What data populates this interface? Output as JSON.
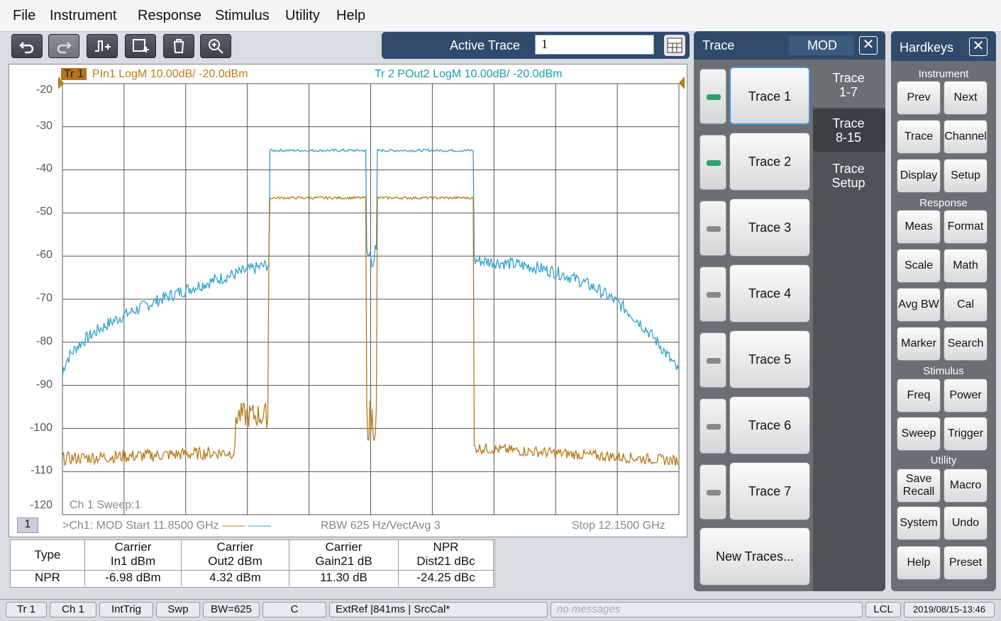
{
  "menu": [
    "File",
    "Instrument",
    "Response",
    "Stimulus",
    "Utility",
    "Help"
  ],
  "active_trace": {
    "label": "Active Trace",
    "value": "1"
  },
  "plot": {
    "tr1_tag": "Tr 1",
    "tr1_header": "PIn1 LogM 10.00dB/ -20.0dBm",
    "tr2_header": "Tr 2  POut2 LogM 10.00dB/ -20.0dBm",
    "y_labels": [
      "-20",
      "-30",
      "-40",
      "-50",
      "-60",
      "-70",
      "-80",
      "-90",
      "-100",
      "-110",
      "-120"
    ],
    "sweep_label": "Ch 1 Sweep:1",
    "channel_num": "1",
    "footer_left": ">Ch1: MOD  Start  11.8500 GHz",
    "footer_mid": "RBW  625 Hz/VectAvg 3",
    "footer_right": "Stop  12.1500 GHz",
    "colors": {
      "trace1": "#b8791a",
      "trace2": "#2f9fd0",
      "grid": "#555555"
    }
  },
  "table": {
    "headers": [
      [
        "Type",
        ""
      ],
      [
        "Carrier",
        "In1 dBm"
      ],
      [
        "Carrier",
        "Out2 dBm"
      ],
      [
        "Carrier",
        "Gain21 dB"
      ],
      [
        "NPR",
        "Dist21 dBc"
      ]
    ],
    "row": [
      "NPR",
      "-6.98 dBm",
      "4.32 dBm",
      "11.30 dB",
      "-24.25 dBc"
    ]
  },
  "trace_panel": {
    "title": "Trace",
    "mode": "MOD",
    "traces": [
      "Trace 1",
      "Trace 2",
      "Trace 3",
      "Trace 4",
      "Trace 5",
      "Trace 6",
      "Trace 7"
    ],
    "tabs": [
      "Trace\n1-7",
      "Trace\n8-15",
      "Trace\nSetup"
    ],
    "new_traces": "New Traces..."
  },
  "hardkeys": {
    "title": "Hardkeys",
    "sections": {
      "instrument": "Instrument",
      "response": "Response",
      "stimulus": "Stimulus",
      "utility": "Utility"
    },
    "buttons": [
      "Prev",
      "Next",
      "Trace",
      "Channel",
      "Display",
      "Setup",
      "Meas",
      "Format",
      "Scale",
      "Math",
      "Avg BW",
      "Cal",
      "Marker",
      "Search",
      "Freq",
      "Power",
      "Sweep",
      "Trigger",
      "Save Recall",
      "Macro",
      "System",
      "Undo",
      "Help",
      "Preset"
    ]
  },
  "status": {
    "items": [
      "Tr 1",
      "Ch 1",
      "IntTrig",
      "Swp",
      "BW=625",
      "C",
      "ExtRef |841ms | SrcCal*",
      "no messages",
      "LCL",
      "2019/08/15-13:46"
    ]
  }
}
